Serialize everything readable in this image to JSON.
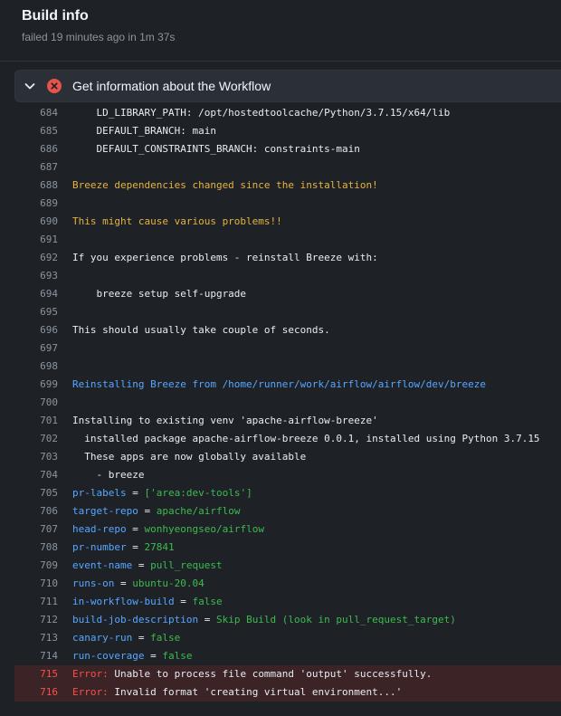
{
  "header": {
    "title": "Build info",
    "status": "failed 19 minutes ago in 1m 37s"
  },
  "step": {
    "title": "Get information about the Workflow",
    "status_color": "#f85149"
  },
  "log_lines": [
    {
      "n": "684",
      "parts": [
        {
          "t": "    LD_LIBRARY_PATH: /opt/hostedtoolcache/Python/3.7.15/x64/lib",
          "c": "plain"
        }
      ]
    },
    {
      "n": "685",
      "parts": [
        {
          "t": "    DEFAULT_BRANCH: main",
          "c": "plain"
        }
      ]
    },
    {
      "n": "686",
      "parts": [
        {
          "t": "    DEFAULT_CONSTRAINTS_BRANCH: constraints-main",
          "c": "plain"
        }
      ]
    },
    {
      "n": "687",
      "parts": []
    },
    {
      "n": "688",
      "parts": [
        {
          "t": "Breeze dependencies changed since the installation!",
          "c": "yellow"
        }
      ]
    },
    {
      "n": "689",
      "parts": []
    },
    {
      "n": "690",
      "parts": [
        {
          "t": "This might cause various problems!!",
          "c": "yellow"
        }
      ]
    },
    {
      "n": "691",
      "parts": []
    },
    {
      "n": "692",
      "parts": [
        {
          "t": "If you experience problems - reinstall Breeze with:",
          "c": "plain"
        }
      ]
    },
    {
      "n": "693",
      "parts": []
    },
    {
      "n": "694",
      "parts": [
        {
          "t": "    breeze setup self-upgrade",
          "c": "plain"
        }
      ]
    },
    {
      "n": "695",
      "parts": []
    },
    {
      "n": "696",
      "parts": [
        {
          "t": "This should usually take couple of seconds.",
          "c": "plain"
        }
      ]
    },
    {
      "n": "697",
      "parts": []
    },
    {
      "n": "698",
      "parts": []
    },
    {
      "n": "699",
      "parts": [
        {
          "t": "Reinstalling Breeze from /home/runner/work/airflow/airflow/dev/breeze",
          "c": "blue"
        }
      ]
    },
    {
      "n": "700",
      "parts": []
    },
    {
      "n": "701",
      "parts": [
        {
          "t": "Installing to existing venv 'apache-airflow-breeze'",
          "c": "plain"
        }
      ]
    },
    {
      "n": "702",
      "parts": [
        {
          "t": "  installed package apache-airflow-breeze 0.0.1, installed using Python 3.7.15",
          "c": "plain"
        }
      ]
    },
    {
      "n": "703",
      "parts": [
        {
          "t": "  These apps are now globally available",
          "c": "plain"
        }
      ]
    },
    {
      "n": "704",
      "parts": [
        {
          "t": "    - breeze",
          "c": "plain"
        }
      ]
    },
    {
      "n": "705",
      "parts": [
        {
          "t": "pr-labels",
          "c": "blue"
        },
        {
          "t": " = ",
          "c": "plain"
        },
        {
          "t": "['area:dev-tools']",
          "c": "green"
        }
      ]
    },
    {
      "n": "706",
      "parts": [
        {
          "t": "target-repo",
          "c": "blue"
        },
        {
          "t": " = ",
          "c": "plain"
        },
        {
          "t": "apache/airflow",
          "c": "green"
        }
      ]
    },
    {
      "n": "707",
      "parts": [
        {
          "t": "head-repo",
          "c": "blue"
        },
        {
          "t": " = ",
          "c": "plain"
        },
        {
          "t": "wonhyeongseo/airflow",
          "c": "green"
        }
      ]
    },
    {
      "n": "708",
      "parts": [
        {
          "t": "pr-number",
          "c": "blue"
        },
        {
          "t": " = ",
          "c": "plain"
        },
        {
          "t": "27841",
          "c": "green"
        }
      ]
    },
    {
      "n": "709",
      "parts": [
        {
          "t": "event-name",
          "c": "blue"
        },
        {
          "t": " = ",
          "c": "plain"
        },
        {
          "t": "pull_request",
          "c": "green"
        }
      ]
    },
    {
      "n": "710",
      "parts": [
        {
          "t": "runs-on",
          "c": "blue"
        },
        {
          "t": " = ",
          "c": "plain"
        },
        {
          "t": "ubuntu-20.04",
          "c": "green"
        }
      ]
    },
    {
      "n": "711",
      "parts": [
        {
          "t": "in-workflow-build",
          "c": "blue"
        },
        {
          "t": " = ",
          "c": "plain"
        },
        {
          "t": "false",
          "c": "green"
        }
      ]
    },
    {
      "n": "712",
      "parts": [
        {
          "t": "build-job-description",
          "c": "blue"
        },
        {
          "t": " = ",
          "c": "plain"
        },
        {
          "t": "Skip Build (look in pull_request_target)",
          "c": "green"
        }
      ]
    },
    {
      "n": "713",
      "parts": [
        {
          "t": "canary-run",
          "c": "blue"
        },
        {
          "t": " = ",
          "c": "plain"
        },
        {
          "t": "false",
          "c": "green"
        }
      ]
    },
    {
      "n": "714",
      "parts": [
        {
          "t": "run-coverage",
          "c": "blue"
        },
        {
          "t": " = ",
          "c": "plain"
        },
        {
          "t": "false",
          "c": "green"
        }
      ]
    },
    {
      "n": "715",
      "error": true,
      "parts": [
        {
          "t": "Error:",
          "c": "red"
        },
        {
          "t": " Unable to process file command 'output' successfully.",
          "c": "plain"
        }
      ]
    },
    {
      "n": "716",
      "error": true,
      "parts": [
        {
          "t": "Error:",
          "c": "red"
        },
        {
          "t": " Invalid format 'creating virtual environment...'",
          "c": "plain"
        }
      ]
    }
  ]
}
